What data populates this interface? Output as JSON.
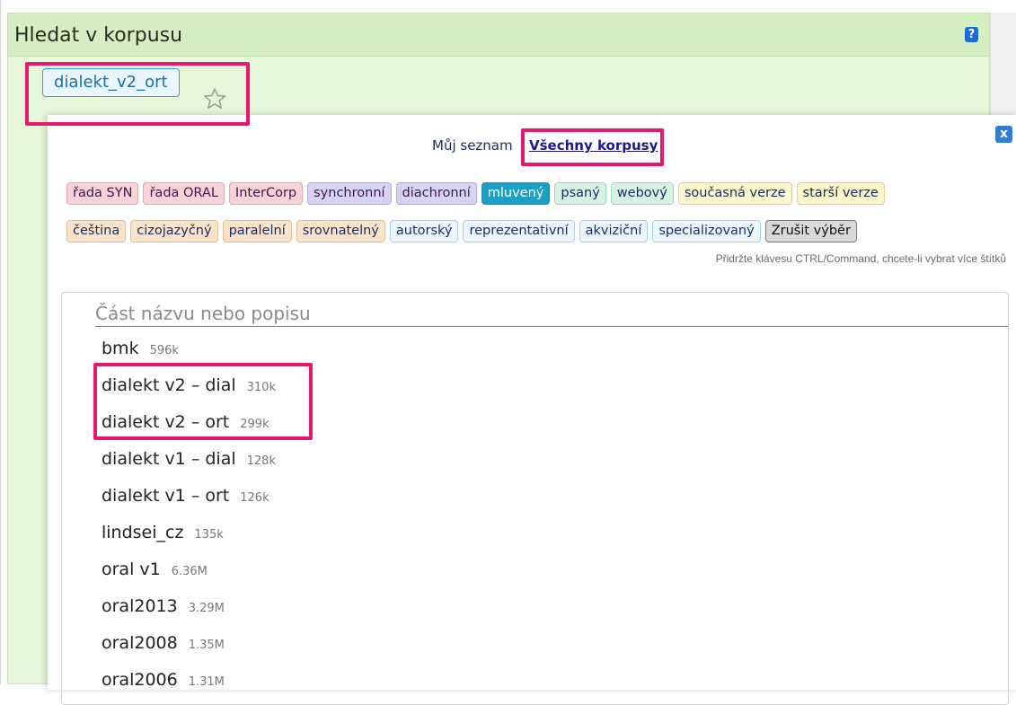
{
  "panel": {
    "title": "Hledat v korpusu",
    "help_label": "?"
  },
  "current_corpus": "dialekt_v2_ort",
  "popup": {
    "close_label": "x",
    "tabs": [
      {
        "label": "Můj seznam",
        "active": false
      },
      {
        "label": "Všechny korpusy",
        "active": true
      }
    ],
    "tag_rows": [
      [
        {
          "label": "řada SYN",
          "bg": "#f9d1d6",
          "border": "#e8a3ad",
          "color": "#3b1a57"
        },
        {
          "label": "řada ORAL",
          "bg": "#f9d1d6",
          "border": "#e8a3ad",
          "color": "#3b1a57"
        },
        {
          "label": "InterCorp",
          "bg": "#f9d1d6",
          "border": "#e8a3ad",
          "color": "#3b1a57"
        },
        {
          "label": "synchronní",
          "bg": "#d7d3f5",
          "border": "#aea6e6",
          "color": "#3b1a57"
        },
        {
          "label": "diachronní",
          "bg": "#d7d3f5",
          "border": "#aea6e6",
          "color": "#3b1a57"
        },
        {
          "label": "mluvený",
          "bg": "#1aa0c4",
          "border": "#1a8fb0",
          "color": "#ffffff"
        },
        {
          "label": "psaný",
          "bg": "#d6f2e3",
          "border": "#9fd9bb",
          "color": "#1a2b5e"
        },
        {
          "label": "webový",
          "bg": "#d6f2e3",
          "border": "#9fd9bb",
          "color": "#1a2b5e"
        },
        {
          "label": "současná verze",
          "bg": "#fbf6cc",
          "border": "#dcd28e",
          "color": "#1a2b5e"
        },
        {
          "label": "starší verze",
          "bg": "#fbf6cc",
          "border": "#dcd28e",
          "color": "#1a2b5e"
        }
      ],
      [
        {
          "label": "čeština",
          "bg": "#fbe3c9",
          "border": "#e2bf95",
          "color": "#1a2b5e"
        },
        {
          "label": "cizojazyčný",
          "bg": "#fbe3c9",
          "border": "#e2bf95",
          "color": "#1a2b5e"
        },
        {
          "label": "paralelní",
          "bg": "#fbe3c9",
          "border": "#e2bf95",
          "color": "#1a2b5e"
        },
        {
          "label": "srovnatelný",
          "bg": "#fbe3c9",
          "border": "#e2bf95",
          "color": "#1a2b5e"
        },
        {
          "label": "autorský",
          "bg": "#eaf7ff",
          "border": "#9fd2ee",
          "color": "#1a2b5e"
        },
        {
          "label": "reprezentativní",
          "bg": "#eaf7ff",
          "border": "#9fd2ee",
          "color": "#1a2b5e"
        },
        {
          "label": "akviziční",
          "bg": "#eaf7ff",
          "border": "#9fd2ee",
          "color": "#1a2b5e"
        },
        {
          "label": "specializovaný",
          "bg": "#eaf7ff",
          "border": "#9fd2ee",
          "color": "#1a2b5e"
        },
        {
          "label": "Zrušit výběr",
          "bg": "#d9d9d9",
          "border": "#7b7b7b",
          "color": "#111111"
        }
      ]
    ],
    "hint": "Přidržte klávesu CTRL/Command, chcete-li vybrat více štítků",
    "search_placeholder": "Část názvu nebo popisu",
    "corpora": [
      {
        "name": "bmk",
        "size": "596k"
      },
      {
        "name": "dialekt v2 – dial",
        "size": "310k"
      },
      {
        "name": "dialekt v2 – ort",
        "size": "299k"
      },
      {
        "name": "dialekt v1 – dial",
        "size": "128k"
      },
      {
        "name": "dialekt v1 – ort",
        "size": "126k"
      },
      {
        "name": "lindsei_cz",
        "size": "135k"
      },
      {
        "name": "oral v1",
        "size": "6.36M"
      },
      {
        "name": "oral2013",
        "size": "3.29M"
      },
      {
        "name": "oral2008",
        "size": "1.35M"
      },
      {
        "name": "oral2006",
        "size": "1.31M"
      }
    ]
  },
  "colors": {
    "highlight": "#e8176d",
    "panel_bg": "#e6f7d9",
    "accent_blue": "#2f7dd4"
  }
}
